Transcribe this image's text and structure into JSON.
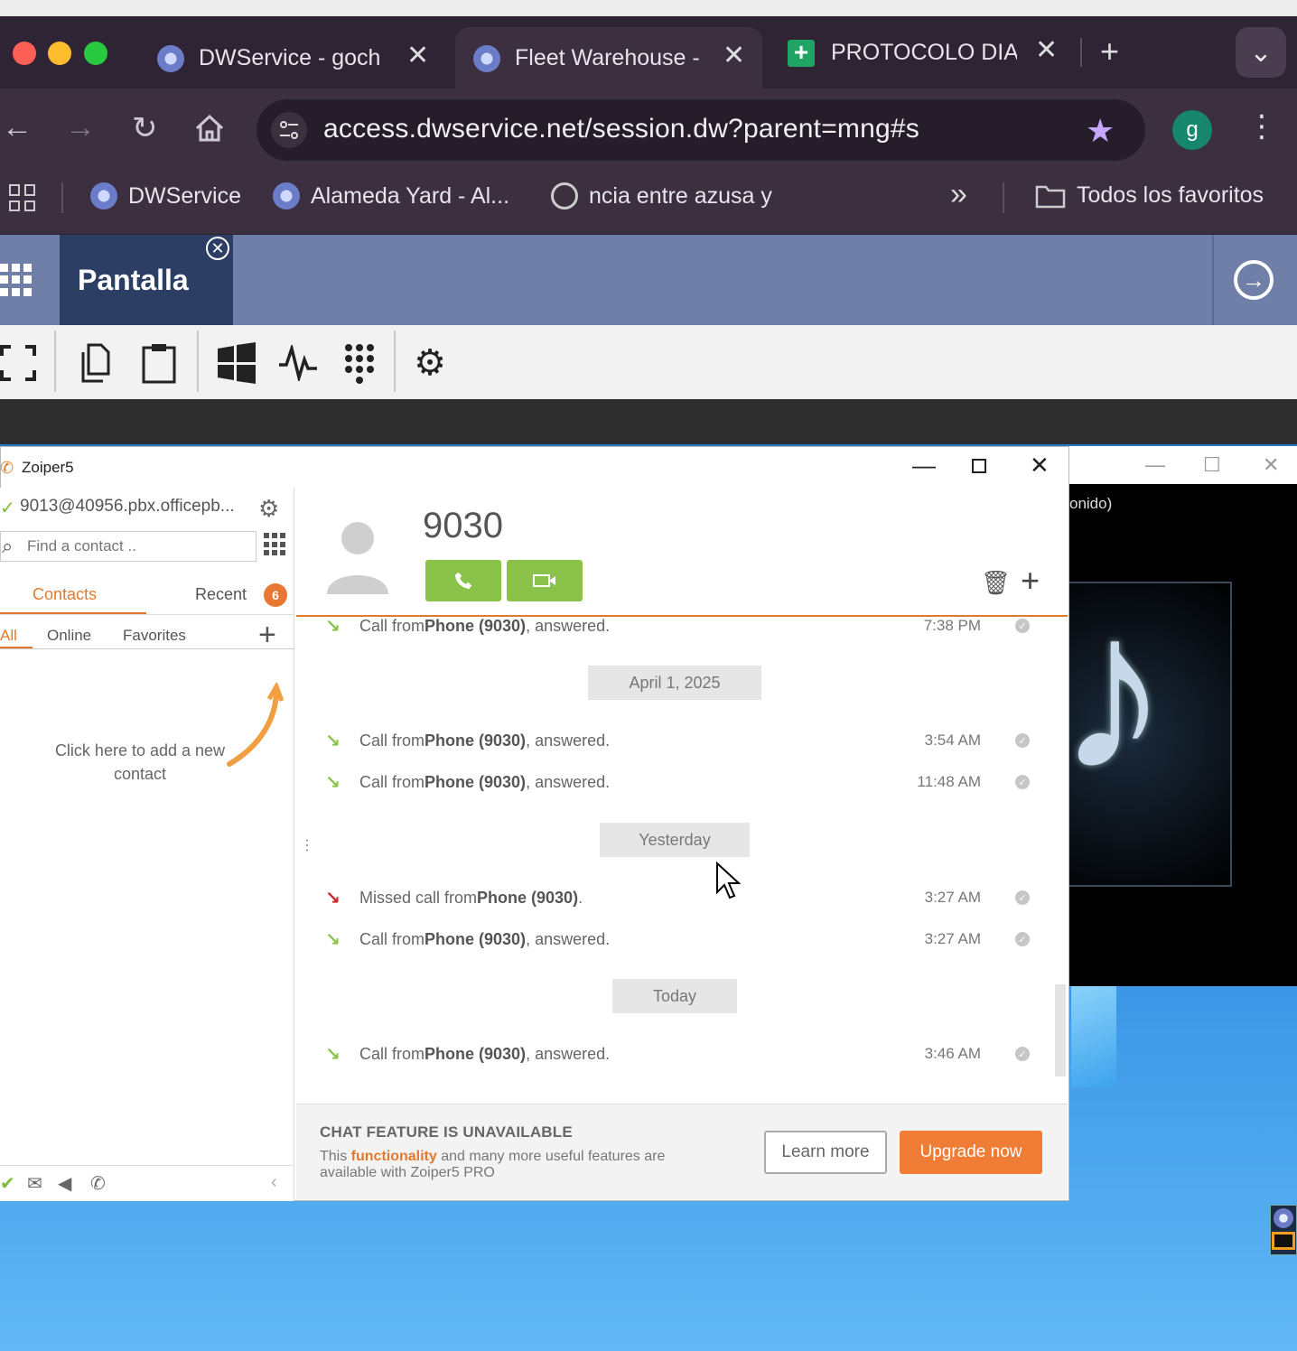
{
  "browser": {
    "tabs": [
      {
        "title": "DWService - goch",
        "close": "✕"
      },
      {
        "title": "Fleet Warehouse -",
        "close": "✕"
      },
      {
        "title": "PROTOCOLO DIAR",
        "close": "✕"
      }
    ],
    "new_tab": "+",
    "tab_menu": "⌄",
    "url": "access.dwservice.net/session.dw?parent=mng#s",
    "profile_initial": "g",
    "bookmarks": [
      {
        "label": "DWService"
      },
      {
        "label": "Alameda Yard - Al..."
      },
      {
        "label": "ncia entre azusa y"
      }
    ],
    "bookmarks_overflow": "»",
    "all_bookmarks": "Todos los favoritos"
  },
  "dwservice": {
    "tab_title": "Pantalla"
  },
  "desktop": {
    "bg_window_text": "onido)"
  },
  "zoiper": {
    "window_title": "Zoiper5",
    "account": "9013@40956.pbx.officepb...",
    "search_placeholder": "Find a contact ..",
    "tabs": {
      "contacts": "Contacts",
      "recent": "Recent",
      "recent_badge": "6"
    },
    "subtabs": {
      "all": "All",
      "online": "Online",
      "favorites": "Favorites"
    },
    "empty_hint": "Click here to add a new contact",
    "contact_name": "9030",
    "history": [
      {
        "type": "row",
        "status": "answered",
        "prefix": "Call from ",
        "who": "Phone (9030)",
        "suffix": ", answered.",
        "time": "7:38 PM"
      },
      {
        "type": "date",
        "label": "April 1, 2025"
      },
      {
        "type": "row",
        "status": "answered",
        "prefix": "Call from ",
        "who": "Phone (9030)",
        "suffix": ", answered.",
        "time": "3:54 AM"
      },
      {
        "type": "row",
        "status": "answered",
        "prefix": "Call from ",
        "who": "Phone (9030)",
        "suffix": ", answered.",
        "time": "11:48 AM"
      },
      {
        "type": "date",
        "label": "Yesterday"
      },
      {
        "type": "row",
        "status": "missed",
        "prefix": "Missed call from ",
        "who": "Phone (9030)",
        "suffix": ".",
        "time": "3:27 AM"
      },
      {
        "type": "row",
        "status": "answered",
        "prefix": "Call from ",
        "who": "Phone (9030)",
        "suffix": ", answered.",
        "time": "3:27 AM"
      },
      {
        "type": "date",
        "label": "Today"
      },
      {
        "type": "row",
        "status": "answered",
        "prefix": "Call from ",
        "who": "Phone (9030)",
        "suffix": ", answered.",
        "time": "3:46 AM"
      }
    ],
    "chat_footer": {
      "title": "CHAT FEATURE IS UNAVAILABLE",
      "desc_prefix": "This ",
      "desc_highlight": "functionality",
      "desc_suffix": " and many more useful features are available with Zoiper5 PRO",
      "learn_more": "Learn more",
      "upgrade_now": "Upgrade now"
    }
  },
  "colors": {
    "accent_orange": "#e07b2e",
    "call_green": "#8bc34a",
    "missed_red": "#c62828",
    "dw_header": "#6f7fa8"
  }
}
